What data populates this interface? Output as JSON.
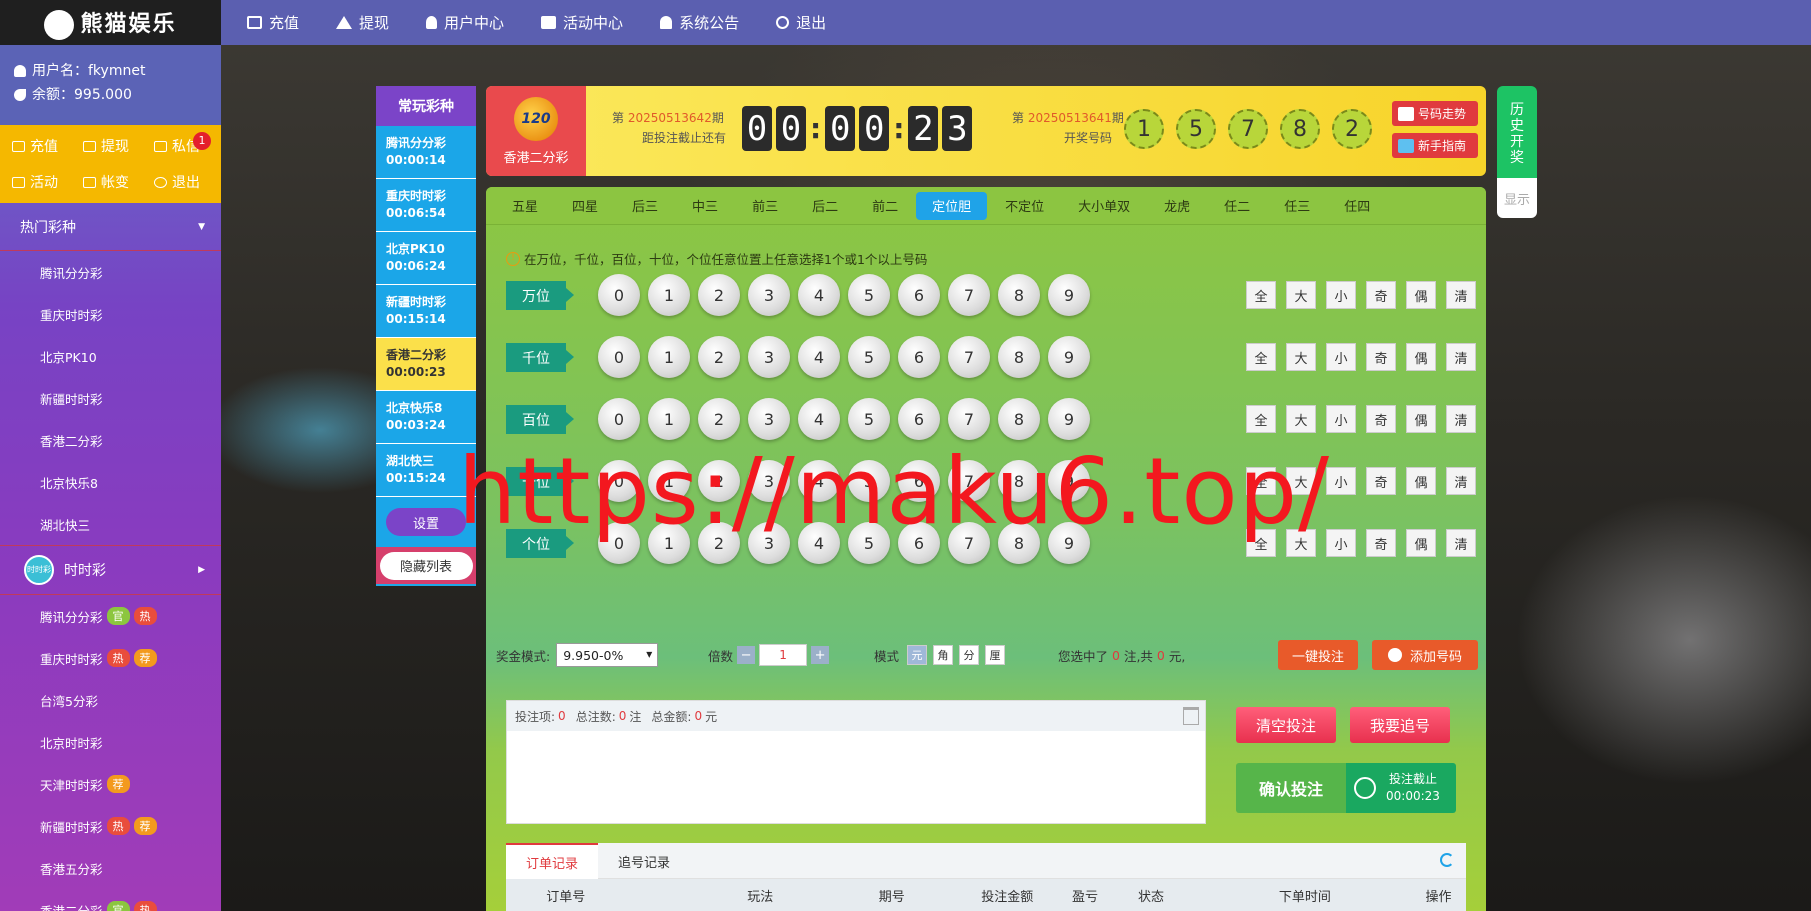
{
  "topbar": {
    "logo_text": "熊猫娱乐",
    "nav": [
      "充值",
      "提现",
      "用户中心",
      "活动中心",
      "系统公告",
      "退出"
    ]
  },
  "sidebar": {
    "username_label": "用户名：",
    "username": "fkymnet",
    "balance_label": "余额：",
    "balance": "995.000",
    "quick": [
      "充值",
      "提现",
      "私信",
      "活动",
      "帐变",
      "退出"
    ],
    "message_count": "1",
    "hot_title": "热门彩种",
    "hot_items": [
      "腾讯分分彩",
      "重庆时时彩",
      "北京PK10",
      "新疆时时彩",
      "香港二分彩",
      "北京快乐8",
      "湖北快三"
    ],
    "ssc_title": "时时彩",
    "ssc_logo_text": "时时彩",
    "ssc_items": [
      {
        "name": "腾讯分分彩",
        "tags": [
          "官",
          "热"
        ]
      },
      {
        "name": "重庆时时彩",
        "tags": [
          "热",
          "荐"
        ]
      },
      {
        "name": "台湾5分彩",
        "tags": []
      },
      {
        "name": "北京时时彩",
        "tags": []
      },
      {
        "name": "天津时时彩",
        "tags": [
          "荐"
        ]
      },
      {
        "name": "新疆时时彩",
        "tags": [
          "热",
          "荐"
        ]
      },
      {
        "name": "香港五分彩",
        "tags": []
      },
      {
        "name": "香港二分彩",
        "tags": [
          "官",
          "热"
        ]
      }
    ]
  },
  "favorites": {
    "title": "常玩彩种",
    "items": [
      {
        "name": "腾讯分分彩",
        "time": "00:00:14"
      },
      {
        "name": "重庆时时彩",
        "time": "00:06:54"
      },
      {
        "name": "北京PK10",
        "time": "00:06:24"
      },
      {
        "name": "新疆时时彩",
        "time": "00:15:14"
      },
      {
        "name": "香港二分彩",
        "time": "00:00:23"
      },
      {
        "name": "北京快乐8",
        "time": "00:03:24"
      },
      {
        "name": "湖北快三",
        "time": "00:15:24"
      }
    ],
    "settings": "设置",
    "hide": "隐藏列表"
  },
  "header": {
    "game_name": "香港二分彩",
    "logo_text": "120",
    "current_prefix": "第",
    "current_issue": "20250513642",
    "current_suffix": "期",
    "countdown_label": "距投注截止还有",
    "countdown_digits": [
      "0",
      "0",
      "0",
      "0",
      "2",
      "3"
    ],
    "last_prefix": "第",
    "last_issue": "20250513641",
    "last_suffix": "期",
    "last_label": "开奖号码",
    "last_numbers": [
      "1",
      "5",
      "7",
      "8",
      "2"
    ],
    "trend_button": "号码走势",
    "guide_button": "新手指南",
    "history_tab": "历史开奖",
    "show_button": "显示"
  },
  "play": {
    "tabs": [
      "五星",
      "四星",
      "后三",
      "中三",
      "前三",
      "后二",
      "前二",
      "定位胆",
      "不定位",
      "大小单双",
      "龙虎",
      "任二",
      "任三",
      "任四"
    ],
    "active_tab": 7,
    "tip": "在万位，千位，百位，十位，个位任意位置上任意选择1个或1个以上号码",
    "positions": [
      "万位",
      "千位",
      "百位",
      "十位",
      "个位"
    ],
    "digits": [
      "0",
      "1",
      "2",
      "3",
      "4",
      "5",
      "6",
      "7",
      "8",
      "9"
    ],
    "quick_buttons": [
      "全",
      "大",
      "小",
      "奇",
      "偶",
      "清"
    ],
    "prize_label": "奖金模式:",
    "prize_value": "9.950-0%",
    "multiple_label": "倍数",
    "multiple_value": "1",
    "mode_label": "模式",
    "modes": [
      "元",
      "角",
      "分",
      "厘"
    ],
    "summary_prefix": "您选中了",
    "summary_count": "0",
    "summary_mid": "注,共",
    "summary_amount": "0",
    "summary_suffix": "元,",
    "one_click_bet": "一键投注",
    "add_number": "添加号码"
  },
  "betlist": {
    "items_label": "投注项:",
    "items_value": "0",
    "total_bets_label": "总注数:",
    "total_bets_value": "0",
    "total_bets_unit": "注",
    "total_amount_label": "总金额:",
    "total_amount_value": "0",
    "total_amount_unit": "元",
    "clear": "清空投注",
    "chase": "我要追号",
    "confirm": "确认投注",
    "deadline_label": "投注截止",
    "deadline_time": "00:00:23"
  },
  "records": {
    "tabs": [
      "订单记录",
      "追号记录"
    ],
    "columns": [
      "订单号",
      "玩法",
      "期号",
      "投注金额",
      "盈亏",
      "状态",
      "下单时间",
      "操作"
    ]
  },
  "watermark": "https://maku6.top/",
  "colors": {
    "topbar": "#5b5fb0",
    "accent_yellow": "#f5b800",
    "active_tab": "#1fa3e8",
    "brand_red": "#e03a3e"
  }
}
